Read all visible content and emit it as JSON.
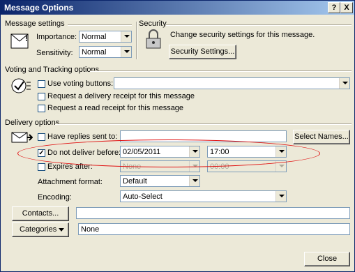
{
  "window": {
    "title": "Message Options",
    "help_label": "?",
    "close_label": "X"
  },
  "message_settings": {
    "heading": "Message settings",
    "importance_label": "Importance:",
    "importance_value": "Normal",
    "sensitivity_label": "Sensitivity:",
    "sensitivity_value": "Normal"
  },
  "security": {
    "heading": "Security",
    "description": "Change security settings for this message.",
    "button_label": "Security Settings..."
  },
  "voting": {
    "heading": "Voting and Tracking options",
    "use_voting_label": "Use voting buttons:",
    "use_voting_value": "",
    "delivery_receipt_label": "Request a delivery receipt for this message",
    "read_receipt_label": "Request a read receipt for this message"
  },
  "delivery": {
    "heading": "Delivery options",
    "have_replies_label": "Have replies sent to:",
    "have_replies_value": "",
    "select_names_label": "Select Names...",
    "do_not_deliver_label": "Do not deliver before:",
    "do_not_deliver_checked": true,
    "do_not_deliver_date": "02/05/2011",
    "do_not_deliver_time": "17:00",
    "expires_label": "Expires after:",
    "expires_date": "None",
    "expires_time": "00:00",
    "attachment_format_label": "Attachment format:",
    "attachment_format_value": "Default",
    "encoding_label": "Encoding:",
    "encoding_value": "Auto-Select"
  },
  "contacts": {
    "button_label": "Contacts...",
    "value": ""
  },
  "categories": {
    "button_label": "Categories",
    "value": "None"
  },
  "footer": {
    "close_label": "Close"
  }
}
